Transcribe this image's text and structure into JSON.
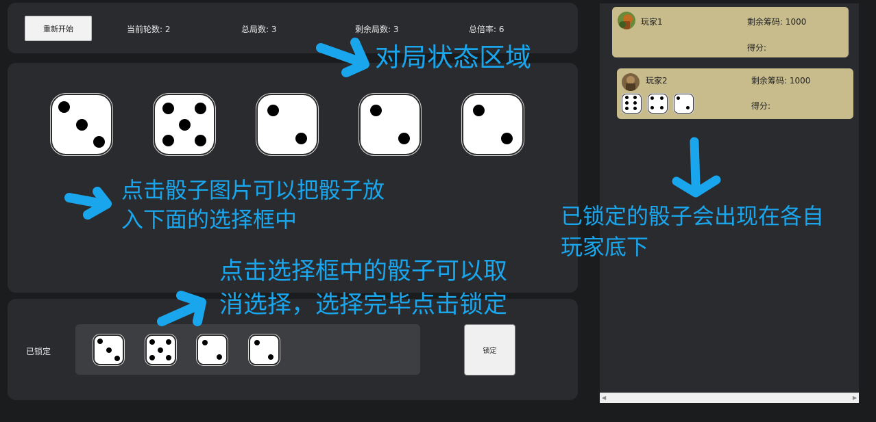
{
  "status": {
    "restart_label": "重新开始",
    "current_round": "当前轮数: 2",
    "total_games": "总局数: 3",
    "remaining_games": "剩余局数: 3",
    "total_multiplier": "总倍率: 6"
  },
  "dice_area": {
    "dice_values": [
      3,
      5,
      2,
      2,
      2
    ]
  },
  "lock_area": {
    "label": "已锁定",
    "locked_dice_values": [
      3,
      5,
      2,
      2
    ],
    "lock_button_label": "锁定"
  },
  "players": [
    {
      "name": "玩家1",
      "chips": "剩余筹码: 1000",
      "score": "得分:",
      "locked_dice_values": []
    },
    {
      "name": "玩家2",
      "chips": "剩余筹码: 1000",
      "score": "得分:",
      "locked_dice_values": [
        6,
        4,
        2
      ]
    }
  ],
  "annotations": {
    "status_area": "对局状态区域",
    "click_dice": [
      "点击骰子图片可以把骰子放",
      "入下面的选择框中"
    ],
    "deselect": [
      "点击选择框中的骰子可以取",
      "消选择，选择完毕点击锁定"
    ],
    "locked_under_player": [
      "已锁定的骰子会出现在各自",
      "玩家底下"
    ]
  },
  "colors": {
    "annotation": "#1aa6ec",
    "player_card": "#c8bc8c",
    "panel": "#2a2b2f"
  }
}
